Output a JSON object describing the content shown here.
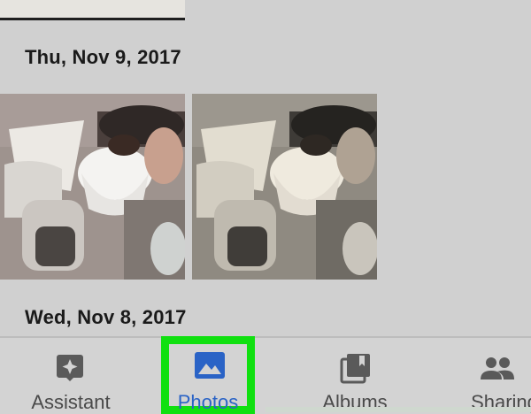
{
  "sections": [
    {
      "date": "Thu, Nov 9, 2017"
    },
    {
      "date": "Wed, Nov 8, 2017"
    }
  ],
  "bottom_nav": {
    "items": [
      {
        "label": "Assistant",
        "icon": "assistant-icon"
      },
      {
        "label": "Photos",
        "icon": "photos-icon",
        "active": true
      },
      {
        "label": "Albums",
        "icon": "albums-icon"
      },
      {
        "label": "Sharing",
        "icon": "sharing-icon"
      }
    ],
    "active_color": "#2a63c6",
    "highlight_color": "#10e010"
  }
}
